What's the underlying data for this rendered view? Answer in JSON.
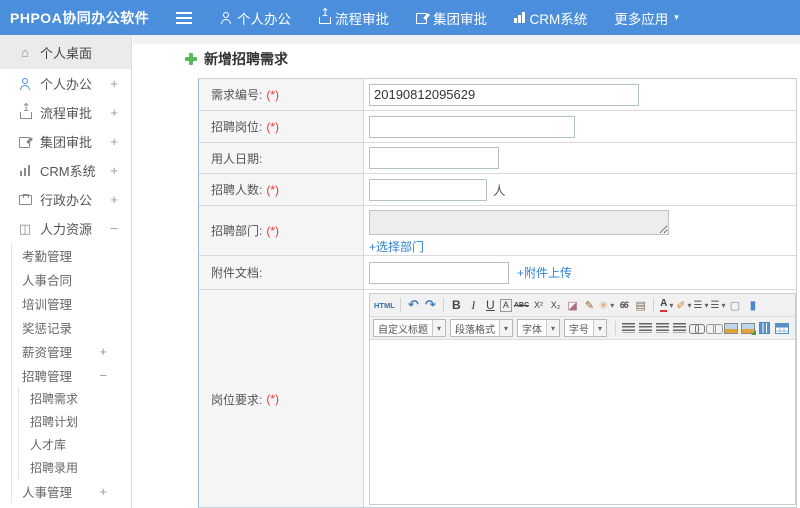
{
  "colors": {
    "topbar": "#4a8edc",
    "link": "#2f82d6",
    "required": "#e33b3b",
    "plus_green": "#5cb75c"
  },
  "icons": {
    "home": "⌂",
    "book": "◫",
    "caret": "▾",
    "hamburger": "menu-bars"
  },
  "topnav": {
    "logo": "PHPOA协同办公软件",
    "items": [
      {
        "label": "个人办公",
        "icon": "person-icon"
      },
      {
        "label": "流程审批",
        "icon": "flow-icon"
      },
      {
        "label": "集团审批",
        "icon": "edit-icon"
      },
      {
        "label": "CRM系统",
        "icon": "chart-icon"
      },
      {
        "label": "更多应用",
        "icon": "caret-down-icon"
      }
    ]
  },
  "sidebar": {
    "top_items": [
      {
        "label": "个人桌面",
        "expand": ""
      },
      {
        "label": "个人办公",
        "expand": "+"
      },
      {
        "label": "流程审批",
        "expand": "+"
      },
      {
        "label": "集团审批",
        "expand": "+"
      },
      {
        "label": "CRM系统",
        "expand": "+"
      },
      {
        "label": "行政办公",
        "expand": "+"
      },
      {
        "label": "人力资源",
        "expand": "−"
      }
    ],
    "hr_sub": [
      {
        "label": "考勤管理",
        "expand": ""
      },
      {
        "label": "人事合同",
        "expand": ""
      },
      {
        "label": "培训管理",
        "expand": ""
      },
      {
        "label": "奖惩记录",
        "expand": ""
      },
      {
        "label": "薪资管理",
        "expand": "+"
      },
      {
        "label": "招聘管理",
        "expand": "−"
      }
    ],
    "recruit_children": [
      {
        "label": "招聘需求"
      },
      {
        "label": "招聘计划"
      },
      {
        "label": "人才库"
      },
      {
        "label": "招聘录用"
      }
    ],
    "hr_sub_tail": [
      {
        "label": "人事管理",
        "expand": "+"
      }
    ]
  },
  "page": {
    "title": "新增招聘需求"
  },
  "form": {
    "required_mark": "(*)",
    "rows": {
      "req_no": {
        "label": "需求编号:",
        "value": "20190812095629"
      },
      "job": {
        "label": "招聘岗位:",
        "value": ""
      },
      "date": {
        "label": "用人日期:",
        "value": ""
      },
      "count": {
        "label": "招聘人数:",
        "value": "",
        "suffix": "人"
      },
      "dept": {
        "label": "招聘部门:",
        "link": "+选择部门"
      },
      "attach": {
        "label": "附件文档:",
        "value": "",
        "link": "+附件上传"
      },
      "requirements": {
        "label": "岗位要求:"
      }
    }
  },
  "editor": {
    "html_btn": "HTML",
    "undo": "↶",
    "redo": "↷",
    "bold": "B",
    "italic": "I",
    "underline": "U",
    "font_box": "A",
    "strike": "ABC",
    "sup": "X²",
    "sub": "X₂",
    "eraser": "◪",
    "brush": "✎",
    "magic": "✳",
    "quote": "66",
    "clip": "▤",
    "font_color": "A",
    "marker": "✐",
    "list": "☰",
    "page": "▢",
    "cut_icon": "▮",
    "selects": [
      {
        "label": "自定义标题"
      },
      {
        "label": "段落格式"
      },
      {
        "label": "字体"
      },
      {
        "label": "字号"
      }
    ]
  }
}
